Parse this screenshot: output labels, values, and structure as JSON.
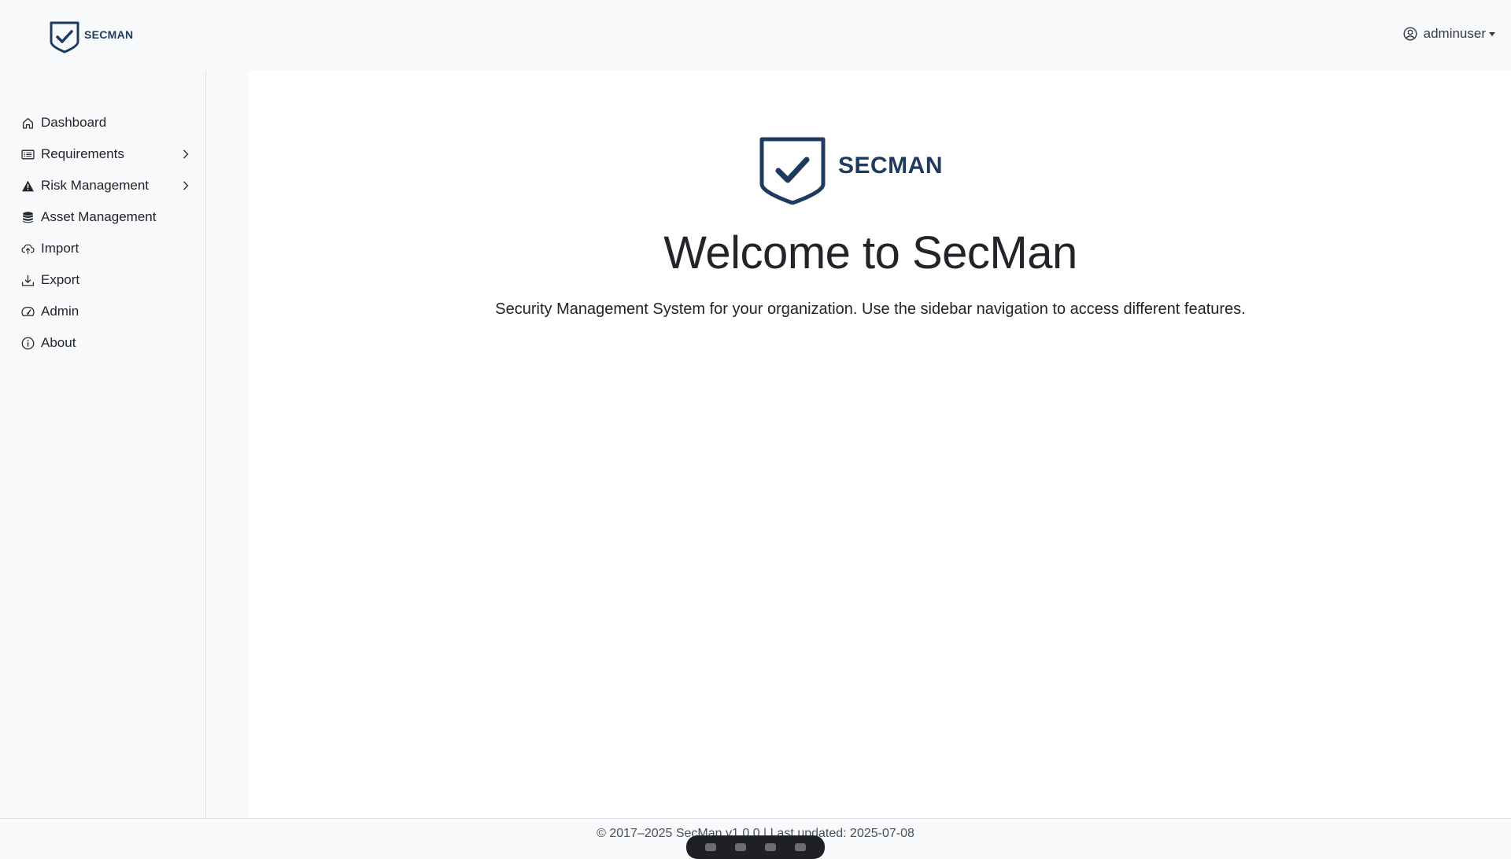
{
  "header": {
    "brand_text": "SECMAN",
    "user_name": "adminuser"
  },
  "sidebar": {
    "items": [
      {
        "label": "Dashboard",
        "icon": "home-icon",
        "has_submenu": false
      },
      {
        "label": "Requirements",
        "icon": "card-list-icon",
        "has_submenu": true
      },
      {
        "label": "Risk Management",
        "icon": "warning-triangle-icon",
        "has_submenu": true
      },
      {
        "label": "Asset Management",
        "icon": "database-icon",
        "has_submenu": false
      },
      {
        "label": "Import",
        "icon": "cloud-upload-icon",
        "has_submenu": false
      },
      {
        "label": "Export",
        "icon": "download-icon",
        "has_submenu": false
      },
      {
        "label": "Admin",
        "icon": "speedometer-icon",
        "has_submenu": false
      },
      {
        "label": "About",
        "icon": "info-circle-icon",
        "has_submenu": false
      }
    ]
  },
  "main": {
    "logo_text": "SECMAN",
    "title": "Welcome to SecMan",
    "subtitle": "Security Management System for your organization. Use the sidebar navigation to access different features."
  },
  "footer": {
    "text": "© 2017–2025 SecMan v1.0.0 | Last updated: 2025-07-08"
  },
  "colors": {
    "brand": "#1e3a5f",
    "background": "#f8f9fa",
    "content": "#ffffff",
    "text": "#212529"
  }
}
